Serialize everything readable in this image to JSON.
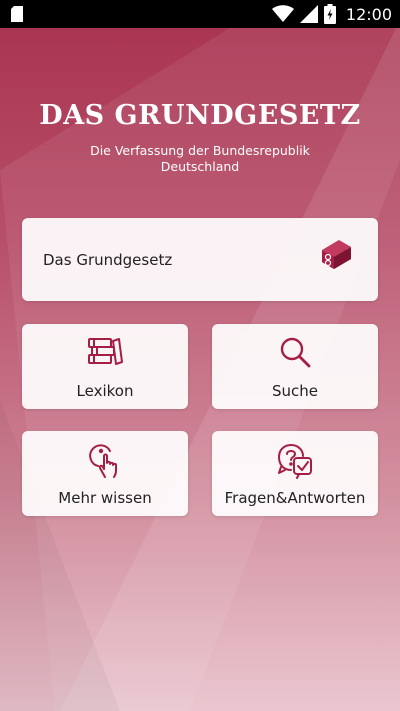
{
  "status_bar": {
    "time": "12:00",
    "battery_level": 0.6,
    "icons": [
      "sim-card-icon",
      "wifi-icon",
      "cell-signal-icon",
      "battery-icon"
    ]
  },
  "header": {
    "title": "DAS GRUNDGESETZ",
    "subtitle": "Die Verfassung der Bundesrepublik Deutschland"
  },
  "menu": {
    "main_item": {
      "label": "Das Grundgesetz",
      "icon": "grundgesetz-books-icon"
    },
    "tiles": [
      {
        "label": "Lexikon",
        "icon": "books-icon"
      },
      {
        "label": "Suche",
        "icon": "search-icon"
      },
      {
        "label": "Mehr wissen",
        "icon": "info-touch-icon"
      },
      {
        "label": "Fragen&Antworten",
        "icon": "question-check-icon"
      }
    ]
  },
  "colors": {
    "accent": "#a51f45",
    "background_top": "#a8324f",
    "background_bottom": "#e8c1cb",
    "card": "#ffffff",
    "text": "#222222"
  }
}
